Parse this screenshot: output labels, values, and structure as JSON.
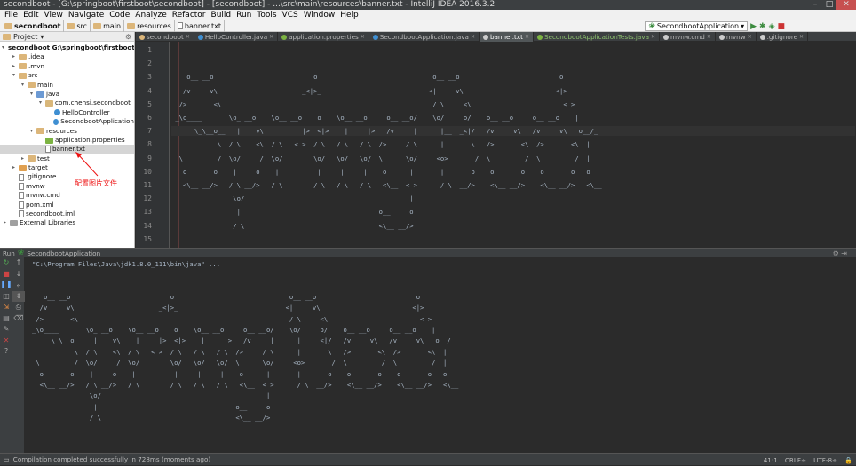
{
  "window": {
    "title": "secondboot - [G:\\springboot\\firstboot\\secondboot] - [secondboot] - ...\\src\\main\\resources\\banner.txt - IntelliJ IDEA 2016.3.2",
    "controls": [
      "–",
      "□",
      "✕"
    ]
  },
  "menu": [
    "File",
    "Edit",
    "View",
    "Navigate",
    "Code",
    "Analyze",
    "Refactor",
    "Build",
    "Run",
    "Tools",
    "VCS",
    "Window",
    "Help"
  ],
  "breadcrumbs": [
    "secondboot",
    "src",
    "main",
    "resources",
    "banner.txt"
  ],
  "run_config": {
    "label": "SecondbootApplication"
  },
  "sidebar": {
    "header": "Project",
    "items": [
      {
        "label": "secondboot  G:\\springboot\\firstboot\\seconc",
        "indent": 0,
        "arrow": "▾",
        "icon": "folder",
        "bold": true
      },
      {
        "label": ".idea",
        "indent": 1,
        "arrow": "▸",
        "icon": "folder"
      },
      {
        "label": ".mvn",
        "indent": 1,
        "arrow": "▸",
        "icon": "folder"
      },
      {
        "label": "src",
        "indent": 1,
        "arrow": "▾",
        "icon": "folder"
      },
      {
        "label": "main",
        "indent": 2,
        "arrow": "▾",
        "icon": "folder"
      },
      {
        "label": "java",
        "indent": 3,
        "arrow": "▾",
        "icon": "folder-blue"
      },
      {
        "label": "com.chensi.secondboot",
        "indent": 4,
        "arrow": "▾",
        "icon": "package"
      },
      {
        "label": "HelloController",
        "indent": 5,
        "arrow": "",
        "icon": "class"
      },
      {
        "label": "SecondbootApplication",
        "indent": 5,
        "arrow": "",
        "icon": "class"
      },
      {
        "label": "resources",
        "indent": 3,
        "arrow": "▾",
        "icon": "folder"
      },
      {
        "label": "application.properties",
        "indent": 4,
        "arrow": "",
        "icon": "props"
      },
      {
        "label": "banner.txt",
        "indent": 4,
        "arrow": "",
        "icon": "file",
        "selected": true
      },
      {
        "label": "test",
        "indent": 2,
        "arrow": "▸",
        "icon": "folder"
      },
      {
        "label": "target",
        "indent": 1,
        "arrow": "▸",
        "icon": "folder-orange"
      },
      {
        "label": ".gitignore",
        "indent": 1,
        "arrow": "",
        "icon": "file"
      },
      {
        "label": "mvnw",
        "indent": 1,
        "arrow": "",
        "icon": "file"
      },
      {
        "label": "mvnw.cmd",
        "indent": 1,
        "arrow": "",
        "icon": "file"
      },
      {
        "label": "pom.xml",
        "indent": 1,
        "arrow": "",
        "icon": "file"
      },
      {
        "label": "secondboot.iml",
        "indent": 1,
        "arrow": "",
        "icon": "file"
      },
      {
        "label": "External Libraries",
        "indent": 0,
        "arrow": "▸",
        "icon": "lib"
      }
    ],
    "annotation": "配置图片文件"
  },
  "tabs": [
    {
      "label": "secondboot",
      "type": "module"
    },
    {
      "label": "HelloController.java",
      "type": "class"
    },
    {
      "label": "application.properties",
      "type": "props"
    },
    {
      "label": "SecondbootApplication.java",
      "type": "class"
    },
    {
      "label": "banner.txt",
      "type": "file",
      "active": true
    },
    {
      "label": "SecondbootApplicationTests.java",
      "type": "test"
    },
    {
      "label": "mvnw.cmd",
      "type": "file"
    },
    {
      "label": "mvnw",
      "type": "file"
    },
    {
      "label": ".gitignore",
      "type": "file"
    }
  ],
  "editor": {
    "current_line": 7,
    "lines": [
      "",
      "",
      "    o__ __o                          o                              o__ __o                          o",
      "   /v     v\\                      _<|>_                            <|     v\\                        <|>",
      "  />       <\\                                                       / \\     <\\                        < >",
      " _\\o____       \\o_ __o    \\o__ __o    o    \\o__ __o     o__ __o/    \\o/     o/    o__ __o     o__ __o    |",
      "      \\_\\__o__   |    v\\    |     |>  <|>    |     |>   /v     |      |__  _<|/   /v     v\\   /v     v\\   o__/_",
      "            \\  / \\    <\\  / \\   < >  / \\   / \\   / \\  />     / \\      |       \\   />       <\\  />       <\\  |",
      "  \\         /  \\o/     /  \\o/        \\o/   \\o/   \\o/  \\      \\o/     <o>       /  \\         /  \\         /  |",
      "   o       o    |     o    |          |     |     |    o      |       |       o    o       o    o       o   o",
      "   <\\__ __/>   / \\ __/>   / \\        / \\   / \\   / \\   <\\__  < >      / \\  __/>    <\\__ __/>    <\\__ __/>   <\\__",
      "                \\o/                                           |",
      "                 |                                    o__     o",
      "                / \\                                   <\\__ __/>",
      ""
    ]
  },
  "run_panel": {
    "title": "Run",
    "config": "SecondbootApplication",
    "command": "\"C:\\Program Files\\Java\\jdk1.8.0_111\\bin\\java\" ...",
    "output": [
      "",
      "",
      "   o__ __o                          o                              o__ __o                          o",
      "  /v     v\\                      _<|>_                            <|     v\\                        <|>",
      " />       <\\                                                       / \\     <\\                        < >",
      "_\\o____       \\o_ __o    \\o__ __o    o    \\o__ __o     o__ __o/    \\o/     o/    o__ __o     o__ __o    |",
      "     \\_\\__o__   |    v\\    |     |>  <|>    |     |>   /v     |      |__  _<|/   /v     v\\   /v     v\\   o__/_",
      "           \\  / \\    <\\  / \\   < >  / \\   / \\   / \\  />     / \\      |       \\   />       <\\  />       <\\  |",
      " \\         /  \\o/     /  \\o/        \\o/   \\o/   \\o/  \\      \\o/     <o>       /  \\         /  \\         /  |",
      "  o       o    |     o    |          |     |     |    o      |       |       o    o       o    o       o   o",
      "  <\\__ __/>   / \\ __/>   / \\        / \\   / \\   / \\   <\\__  < >      / \\  __/>    <\\__ __/>    <\\__ __/>   <\\__",
      "               \\o/                                           |",
      "                |                                    o__     o",
      "               / \\                                   <\\__ __/>"
    ]
  },
  "status": {
    "message": "Compilation completed successfully in 728ms (moments ago)",
    "position": "41:1",
    "line_sep": "CRLF÷",
    "encoding": "UTF-8÷"
  },
  "colors": {
    "editor_bg": "#2b2b2b",
    "ide_chrome": "#3c3f41",
    "annotation": "#ee1111"
  }
}
